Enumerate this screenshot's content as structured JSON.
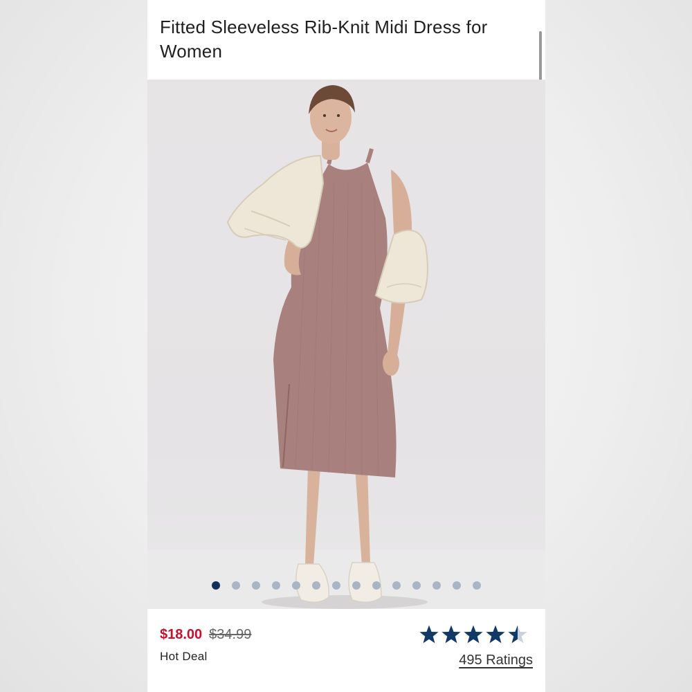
{
  "product": {
    "title": "Fitted Sleeveless Rib-Knit Midi Dress for Women",
    "image_alt": "Woman wearing a mauve sleeveless rib-knit midi dress with a cream jacket draped over her shoulders and white sneakers",
    "dress_color": "#a8807e",
    "jacket_color": "#eee6d6",
    "background_color": "#e6e3e5"
  },
  "gallery": {
    "total_images": 14,
    "active_index": 0,
    "active_color": "#14305a",
    "inactive_color": "#a9b5c5"
  },
  "pricing": {
    "sale_price": "$18.00",
    "original_price": "$34.99",
    "sale_color": "#c8102e",
    "deal_label": "Hot Deal"
  },
  "rating": {
    "value": 4.5,
    "max": 5,
    "star_color": "#0f3a68",
    "count_label": "495 Ratings"
  }
}
